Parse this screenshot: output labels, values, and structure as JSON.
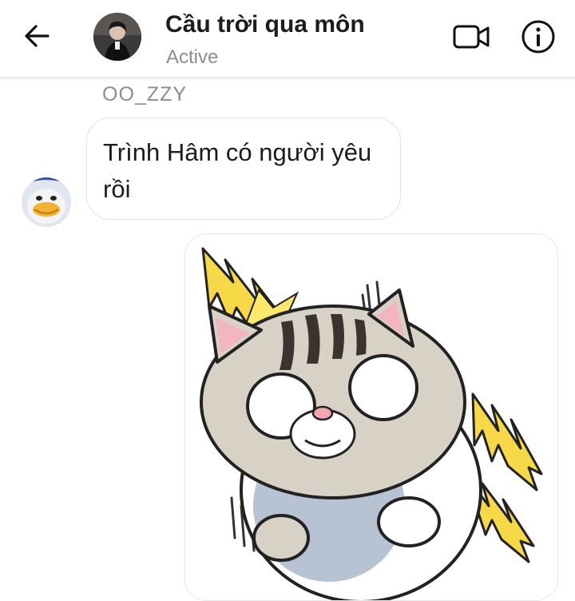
{
  "header": {
    "title": "Cầu trời qua môn",
    "status": "Active",
    "back_icon": "arrow-left-icon",
    "video_icon": "video-camera-icon",
    "info_icon": "info-icon"
  },
  "conversation": {
    "sender_name": "OO_ZZY",
    "messages": [
      {
        "type": "text",
        "from": "OO_ZZY",
        "text": "Trình Hâm có người yêu rồi"
      },
      {
        "type": "sticker",
        "from": "me",
        "sticker": "shocked-cat-sticker"
      }
    ]
  },
  "colors": {
    "background": "#ffffff",
    "title": "#1c1c1c",
    "secondary_text": "#8a8d91",
    "bubble_border": "#e3e3e3"
  }
}
